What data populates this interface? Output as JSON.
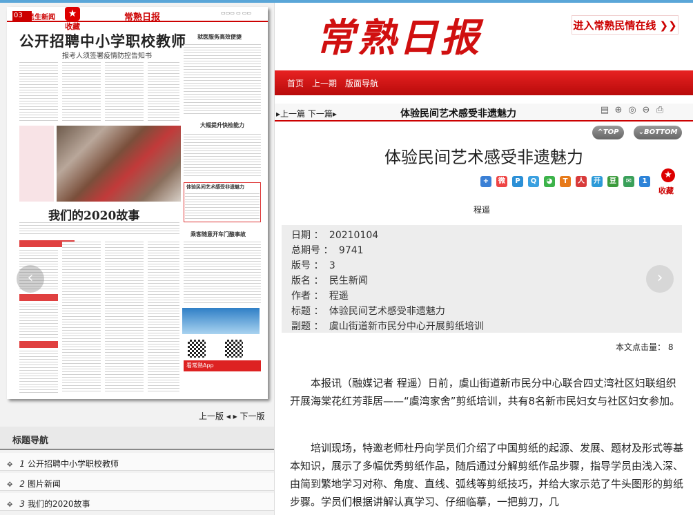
{
  "paper": {
    "page_num": "03",
    "page_name": "民生新闻",
    "fav_label": "收藏",
    "brand": "常熟日报",
    "headline": "公开招聘中小学职校教师",
    "subhead": "报考人须签署疫情防控告知书",
    "story_title": "我们的2020故事",
    "side_head_1": "就医服务高效便捷",
    "side_head_2": "大幅提升快检能力",
    "side_head_3": "体验民间艺术感受非遗魅力",
    "side_head_4": "乘客随意开车门酿事故",
    "app_label": "看常熟App"
  },
  "pager": {
    "prev": "上一版",
    "next": "下一版"
  },
  "title_nav": {
    "heading": "标题导航",
    "items": [
      {
        "num": "1",
        "label": "公开招聘中小学职校教师"
      },
      {
        "num": "2",
        "label": "图片新闻"
      },
      {
        "num": "3",
        "label": "我们的2020故事"
      }
    ]
  },
  "header": {
    "logo": "常熟日报",
    "enter_link": "进入常熟民情在线 ❯❯",
    "nav": [
      "首页",
      "上一期",
      "版面导航"
    ]
  },
  "crumb": {
    "prev": "上一篇",
    "next": "下一篇",
    "title": "体验民间艺术感受非遗魅力"
  },
  "buttons": {
    "top": "TOP",
    "bottom": "BOTTOM"
  },
  "article": {
    "title": "体验民间艺术感受非遗魅力",
    "fav_label": "收藏",
    "author": "程遥",
    "meta": [
      {
        "k": "日期",
        "v": "20210104"
      },
      {
        "k": "总期号",
        "v": "9741"
      },
      {
        "k": "版号",
        "v": "3"
      },
      {
        "k": "版名",
        "v": "民生新闻"
      },
      {
        "k": "作者",
        "v": "程遥"
      },
      {
        "k": "标题",
        "v": "体验民间艺术感受非遗魅力"
      },
      {
        "k": "副题",
        "v": "虞山街道新市民分中心开展剪纸培训"
      }
    ],
    "clicks_label": "本文点击量：",
    "clicks": "8",
    "paragraphs": [
      "本报讯（融媒记者 程遥）日前，虞山街道新市民分中心联合四丈湾社区妇联组织开展海棠花红芳菲居——“虞湾家舍”剪纸培训，共有8名新市民妇女与社区妇女参加。",
      "培训现场，特邀老师杜丹向学员们介绍了中国剪纸的起源、发展、题材及形式等基本知识，展示了多幅优秀剪纸作品，随后通过分解剪纸作品步骤，指导学员由浅入深、由简到繁地学习对称、角度、直线、弧线等剪纸技巧，并给大家示范了牛头图形的剪纸步骤。学员们根据讲解认真学习、仔细临摹，一把剪刀，几"
    ]
  },
  "colors": {
    "brand_red": "#d01010",
    "nav_red": "#c81010",
    "meta_bg": "#ededed"
  }
}
